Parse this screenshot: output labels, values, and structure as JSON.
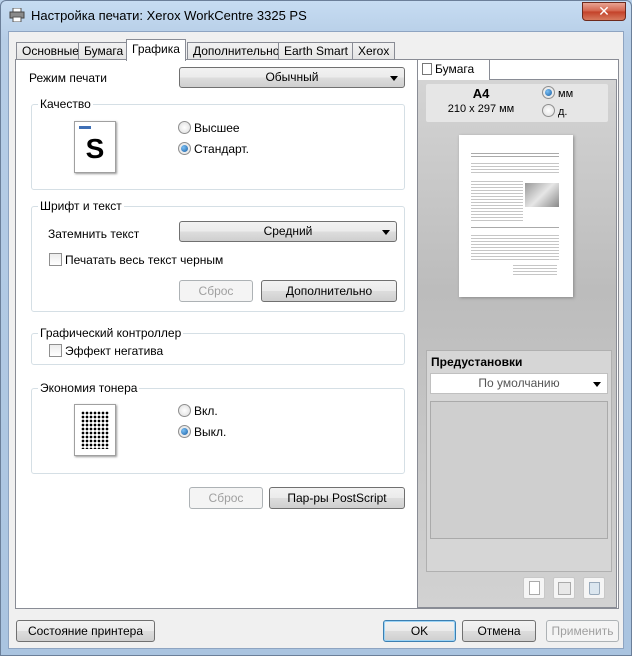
{
  "window": {
    "title": "Настройка печати: Xerox WorkCentre 3325 PS",
    "close": "✕"
  },
  "tabs": [
    "Основные",
    "Бумага",
    "Графика",
    "Дополнительно",
    "Earth Smart",
    "Xerox"
  ],
  "print_mode": {
    "label": "Режим печати",
    "value": "Обычный"
  },
  "quality": {
    "title": "Качество",
    "thumb_letter": "S",
    "options": [
      "Высшее",
      "Стандарт."
    ],
    "selected": "Стандарт."
  },
  "font_text": {
    "title": "Шрифт и текст",
    "darken_label": "Затемнить текст",
    "darken_value": "Средний",
    "black_text": "Печатать весь текст черным",
    "reset": "Сброс",
    "advanced": "Дополнительно"
  },
  "graphic_controller": {
    "title": "Графический контроллер",
    "negative": "Эффект негатива"
  },
  "toner_save": {
    "title": "Экономия тонера",
    "options": [
      "Вкл.",
      "Выкл."
    ],
    "selected": "Выкл."
  },
  "reset_button": "Сброс",
  "postscript_button": "Пар-ры PostScript",
  "paper_panel": {
    "tab": "Бумага",
    "size": "A4",
    "dimensions": "210 x 297 мм",
    "units": [
      "мм",
      "д."
    ],
    "selected_unit": "мм"
  },
  "presets": {
    "title": "Предустановки",
    "value": "По умолчанию"
  },
  "footer": {
    "printer_status": "Состояние принтера",
    "ok": "OK",
    "cancel": "Отмена",
    "apply": "Применить"
  },
  "icons": [
    "printer-icon",
    "new-preset-icon",
    "save-preset-icon",
    "delete-preset-icon"
  ]
}
